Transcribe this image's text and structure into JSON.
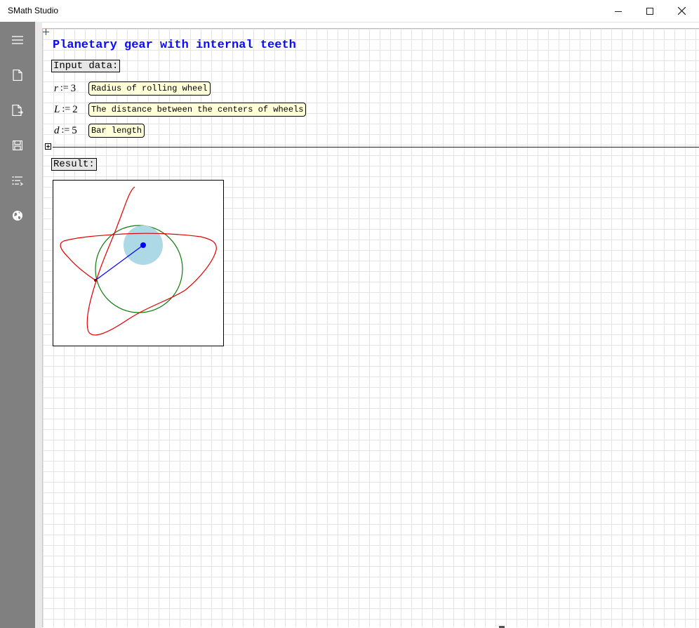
{
  "window": {
    "title": "SMath Studio"
  },
  "sidebar": {
    "icons": [
      "menu-icon",
      "new-file-icon",
      "export-file-icon",
      "save-icon",
      "list-icon",
      "globe-icon"
    ]
  },
  "worksheet": {
    "title": "Planetary gear with internal teeth",
    "input_label": "Input data:",
    "result_label": "Result:",
    "definitions": [
      {
        "var": "r",
        "op": ":=",
        "value": "3",
        "note": "Radius of rolling wheel"
      },
      {
        "var": "L",
        "op": ":=",
        "value": "2",
        "note": "The distance between the centers of wheels"
      },
      {
        "var": "d",
        "op": ":=",
        "value": "5",
        "note": "Bar length"
      }
    ]
  },
  "colors": {
    "title": "#0a0aff",
    "trajectory": "#e00000",
    "fixed_circle": "#0a7a0a",
    "wheel_fill": "#add8e6",
    "bar": "#0000ff",
    "sidebar": "#808080"
  },
  "chart_data": {
    "type": "scatter",
    "series": [
      {
        "name": "",
        "role": "trajectory",
        "color": "#e00000"
      },
      {
        "name": "",
        "role": "fixed circle",
        "color": "#0a7a0a"
      },
      {
        "name": "",
        "role": "rolling wheel",
        "color": "#add8e6"
      },
      {
        "name": "",
        "role": "bar",
        "color": "#0000ff"
      }
    ],
    "title": "",
    "xlabel": "",
    "ylabel": "",
    "grid": false
  }
}
